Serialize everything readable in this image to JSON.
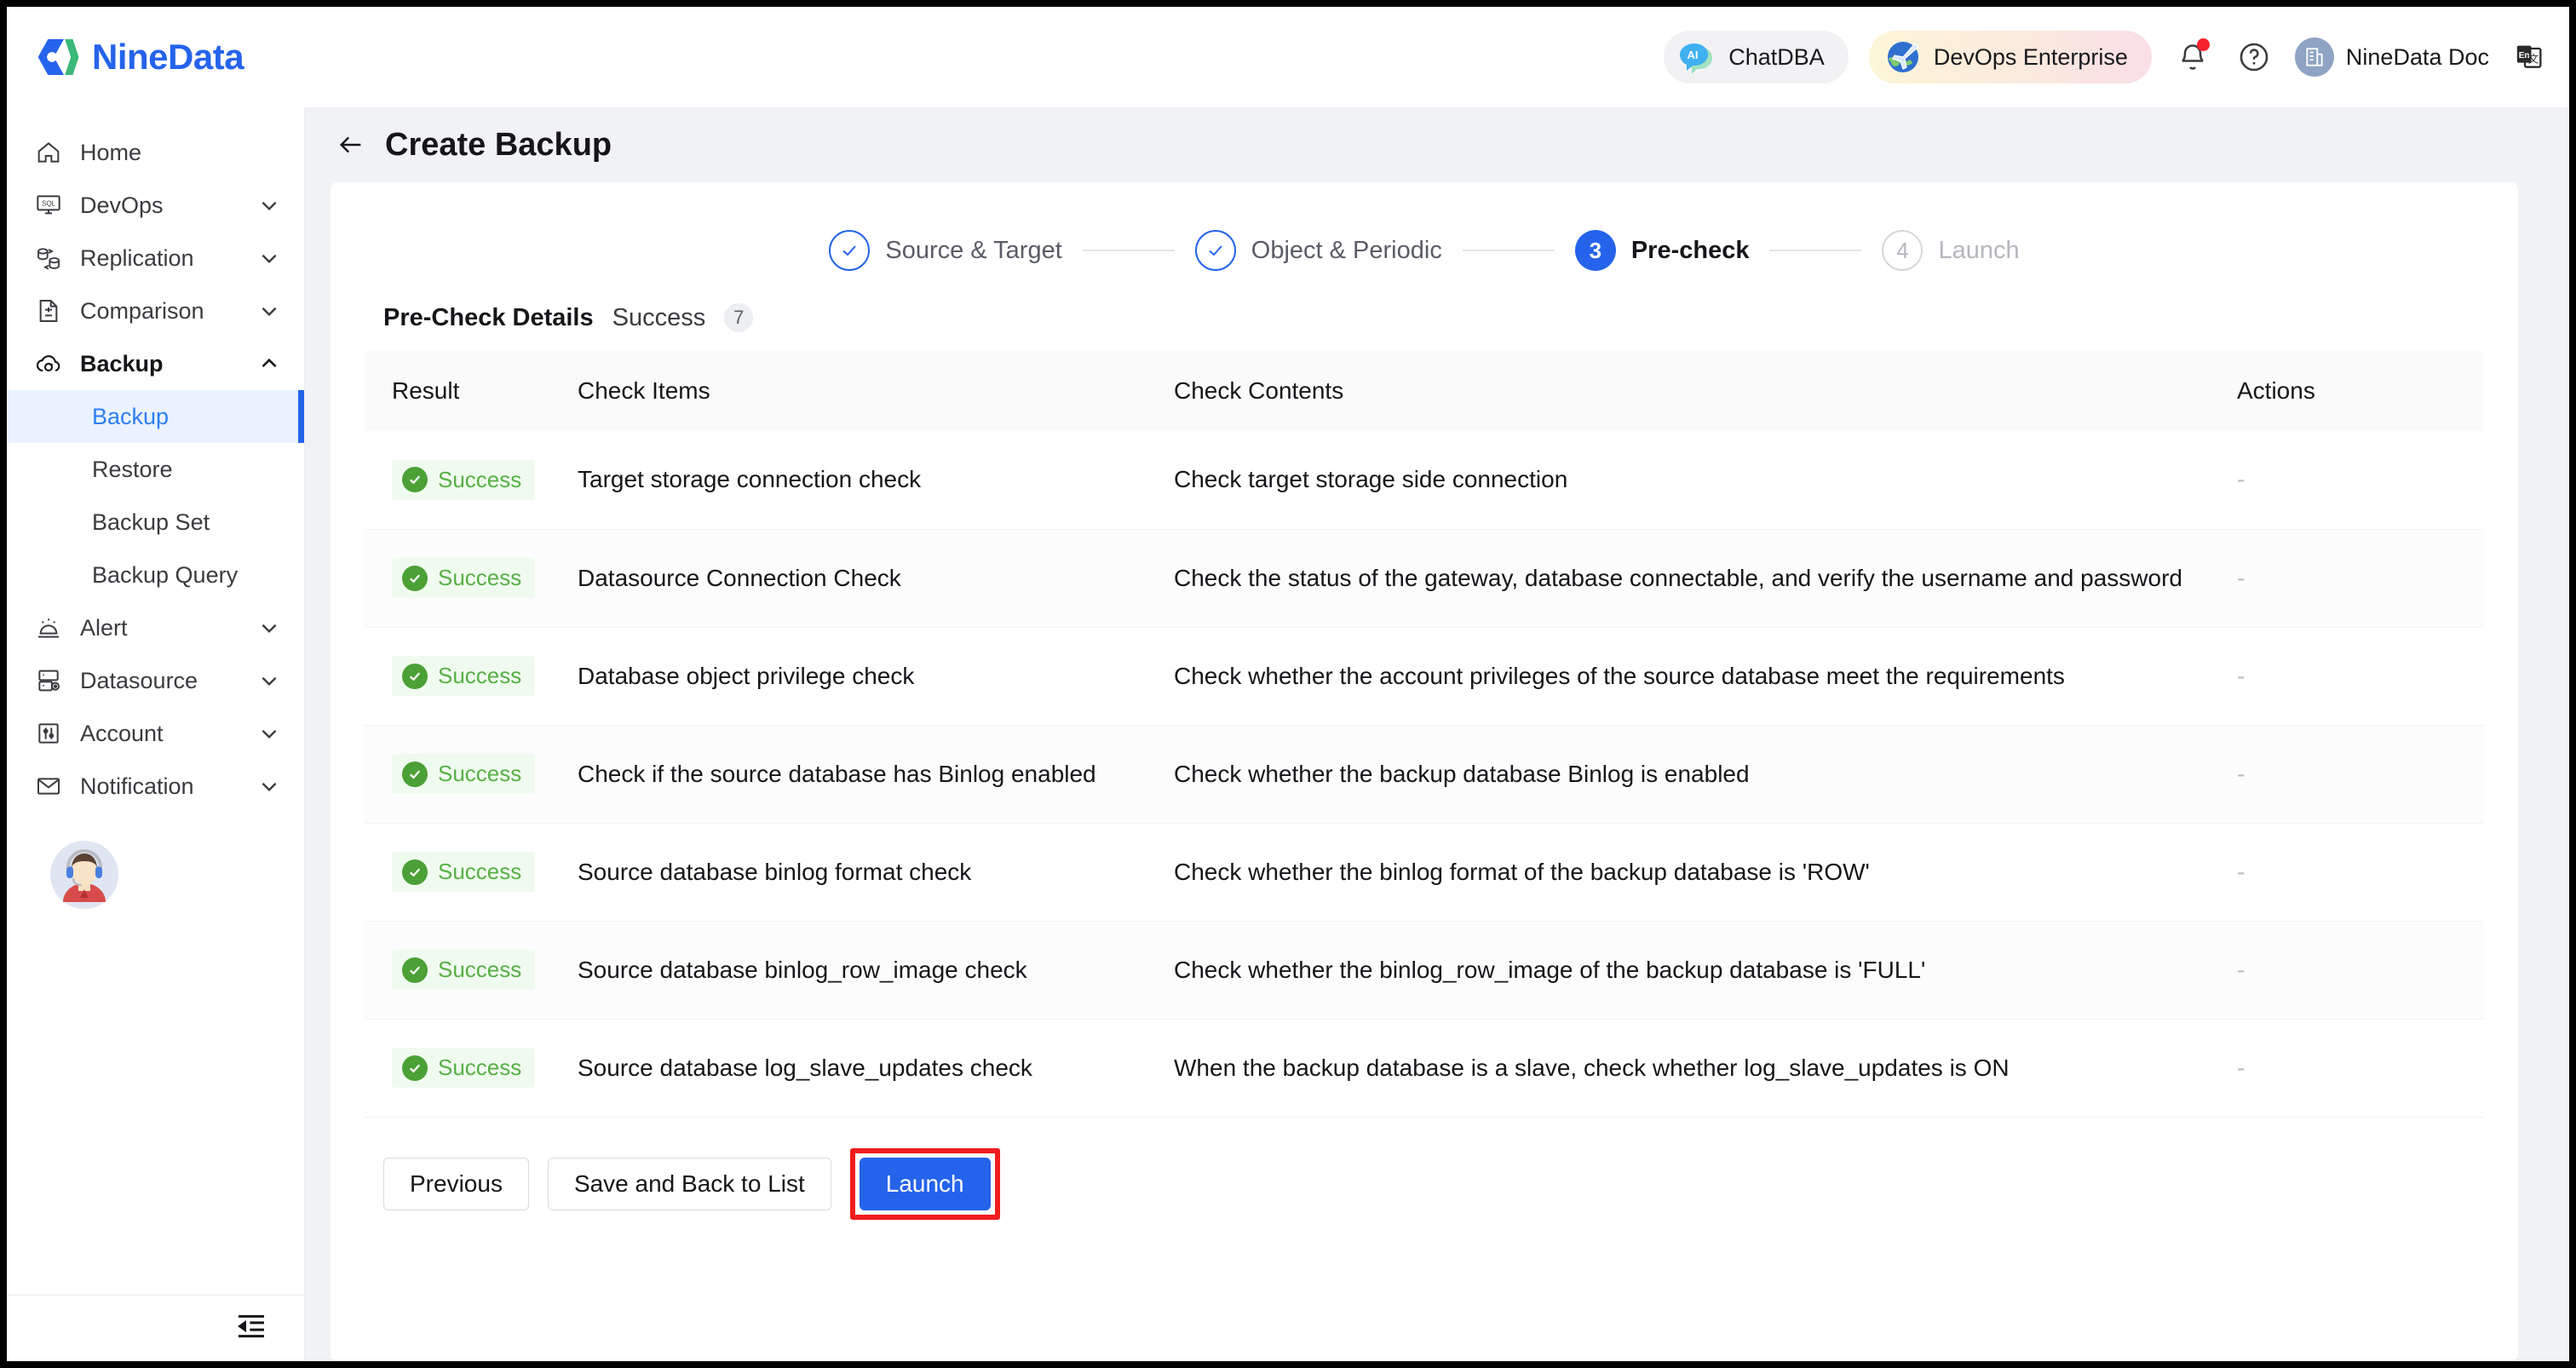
{
  "brand": {
    "name": "NineData"
  },
  "topbar": {
    "chatdba_label": "ChatDBA",
    "devops_label": "DevOps Enterprise",
    "doc_label": "NineData Doc"
  },
  "sidebar": {
    "items": [
      {
        "label": "Home",
        "icon": "home-icon",
        "expandable": false
      },
      {
        "label": "DevOps",
        "icon": "sql-monitor-icon",
        "expandable": true
      },
      {
        "label": "Replication",
        "icon": "replication-icon",
        "expandable": true
      },
      {
        "label": "Comparison",
        "icon": "comparison-icon",
        "expandable": true
      },
      {
        "label": "Backup",
        "icon": "cloud-backup-icon",
        "expandable": true,
        "expanded": true
      }
    ],
    "backup_children": [
      {
        "label": "Backup",
        "active": true
      },
      {
        "label": "Restore",
        "active": false
      },
      {
        "label": "Backup Set",
        "active": false
      },
      {
        "label": "Backup Query",
        "active": false
      }
    ],
    "items_after": [
      {
        "label": "Alert",
        "icon": "alert-icon",
        "expandable": true
      },
      {
        "label": "Datasource",
        "icon": "datasource-icon",
        "expandable": true
      },
      {
        "label": "Account",
        "icon": "account-icon",
        "expandable": true
      },
      {
        "label": "Notification",
        "icon": "notification-icon",
        "expandable": true
      }
    ]
  },
  "page": {
    "title": "Create Backup"
  },
  "stepper": {
    "steps": [
      {
        "number": "1",
        "label": "Source & Target",
        "state": "done"
      },
      {
        "number": "2",
        "label": "Object & Periodic",
        "state": "done"
      },
      {
        "number": "3",
        "label": "Pre-check",
        "state": "current"
      },
      {
        "number": "4",
        "label": "Launch",
        "state": "todo"
      }
    ]
  },
  "details": {
    "title": "Pre-Check Details",
    "status_label": "Success",
    "count": "7"
  },
  "table": {
    "columns": [
      "Result",
      "Check Items",
      "Check Contents",
      "Actions"
    ],
    "rows": [
      {
        "result": "Success",
        "item": "Target storage connection check",
        "contents": "Check target storage side connection",
        "action": "-"
      },
      {
        "result": "Success",
        "item": "Datasource Connection Check",
        "contents": "Check the status of the gateway, database connectable, and verify the username and password",
        "action": "-"
      },
      {
        "result": "Success",
        "item": "Database object privilege check",
        "contents": "Check whether the account privileges of the source database meet the requirements",
        "action": "-"
      },
      {
        "result": "Success",
        "item": "Check if the source database has Binlog enabled",
        "contents": "Check whether the backup database Binlog is enabled",
        "action": "-"
      },
      {
        "result": "Success",
        "item": "Source database binlog format check",
        "contents": "Check whether the binlog format of the backup database is 'ROW'",
        "action": "-"
      },
      {
        "result": "Success",
        "item": "Source database binlog_row_image check",
        "contents": "Check whether the binlog_row_image of the backup database is 'FULL'",
        "action": "-"
      },
      {
        "result": "Success",
        "item": "Source database log_slave_updates check",
        "contents": "When the backup database is a slave, check whether log_slave_updates is ON",
        "action": "-"
      }
    ]
  },
  "footer": {
    "previous_label": "Previous",
    "save_label": "Save and Back to List",
    "launch_label": "Launch"
  },
  "colors": {
    "accent": "#2563eb",
    "success": "#4ba036",
    "success_bg": "#f0fbef",
    "highlight": "#f01c1c",
    "page_bg": "#f0f2f5"
  }
}
